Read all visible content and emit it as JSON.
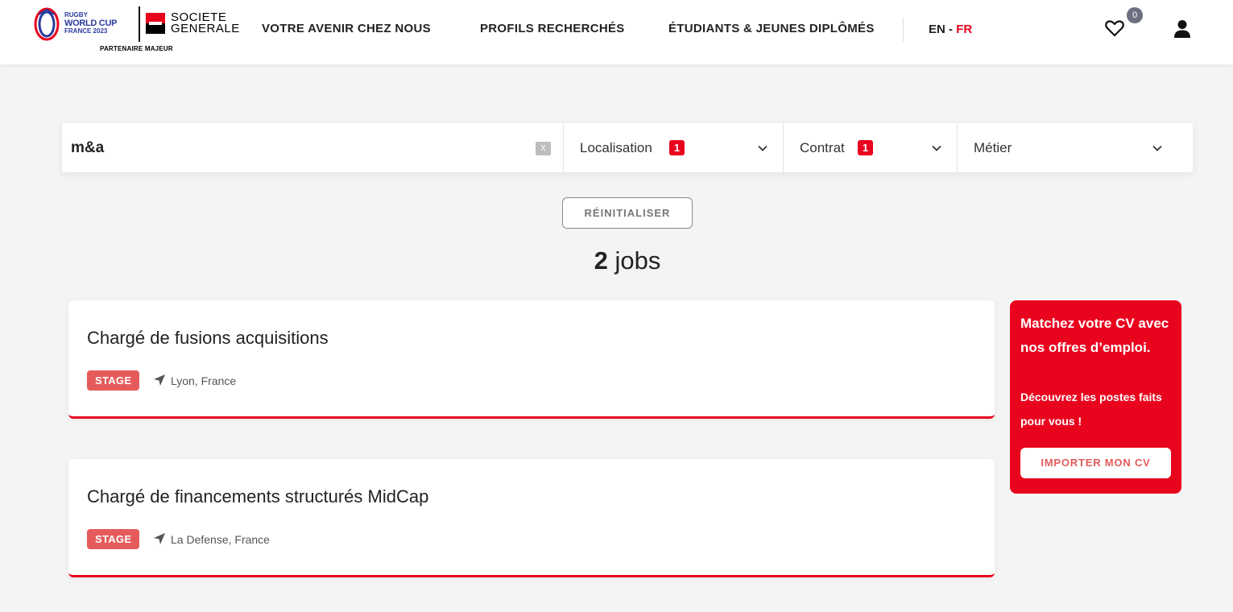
{
  "header": {
    "rwc_logo": {
      "line1": "RUGBY",
      "line2": "WORLD CUP",
      "line3": "FRANCE 2023"
    },
    "sg_logo": {
      "line1": "SOCIETE",
      "line2": "GENERALE"
    },
    "partner_label": "PARTENAIRE MAJEUR",
    "nav": [
      {
        "label": "VOTRE AVENIR CHEZ NOUS"
      },
      {
        "label": "PROFILS RECHERCHÉS"
      },
      {
        "label": "ÉTUDIANTS & JEUNES DIPLÔMÉS"
      }
    ],
    "lang": {
      "en": "EN",
      "separator": " - ",
      "fr": "FR",
      "active": "FR"
    },
    "favorites_count": "0",
    "icons": {
      "favorites": "heart-icon",
      "account": "user-icon"
    }
  },
  "search": {
    "query": "m&a",
    "clear_label": "X",
    "filters": [
      {
        "label": "Localisation",
        "count": "1"
      },
      {
        "label": "Contrat",
        "count": "1"
      },
      {
        "label": "Métier",
        "count": ""
      }
    ]
  },
  "reset_label": "RÉINITIALISER",
  "results": {
    "count": "2",
    "unit": " jobs"
  },
  "jobs": [
    {
      "title": "Chargé de fusions acquisitions",
      "contract": "STAGE",
      "location": "Lyon, France"
    },
    {
      "title": "Chargé de financements structurés MidCap",
      "contract": "STAGE",
      "location": "La Defense, France"
    }
  ],
  "promo": {
    "title": "Matchez votre CV avec nos offres d’emploi.",
    "subtitle": "Découvrez les postes faits pour vous !",
    "button": "IMPORTER MON CV"
  },
  "colors": {
    "brand_red": "#e9041e",
    "tag_red": "#e55b5b",
    "badge_gray": "#6b6f80"
  }
}
